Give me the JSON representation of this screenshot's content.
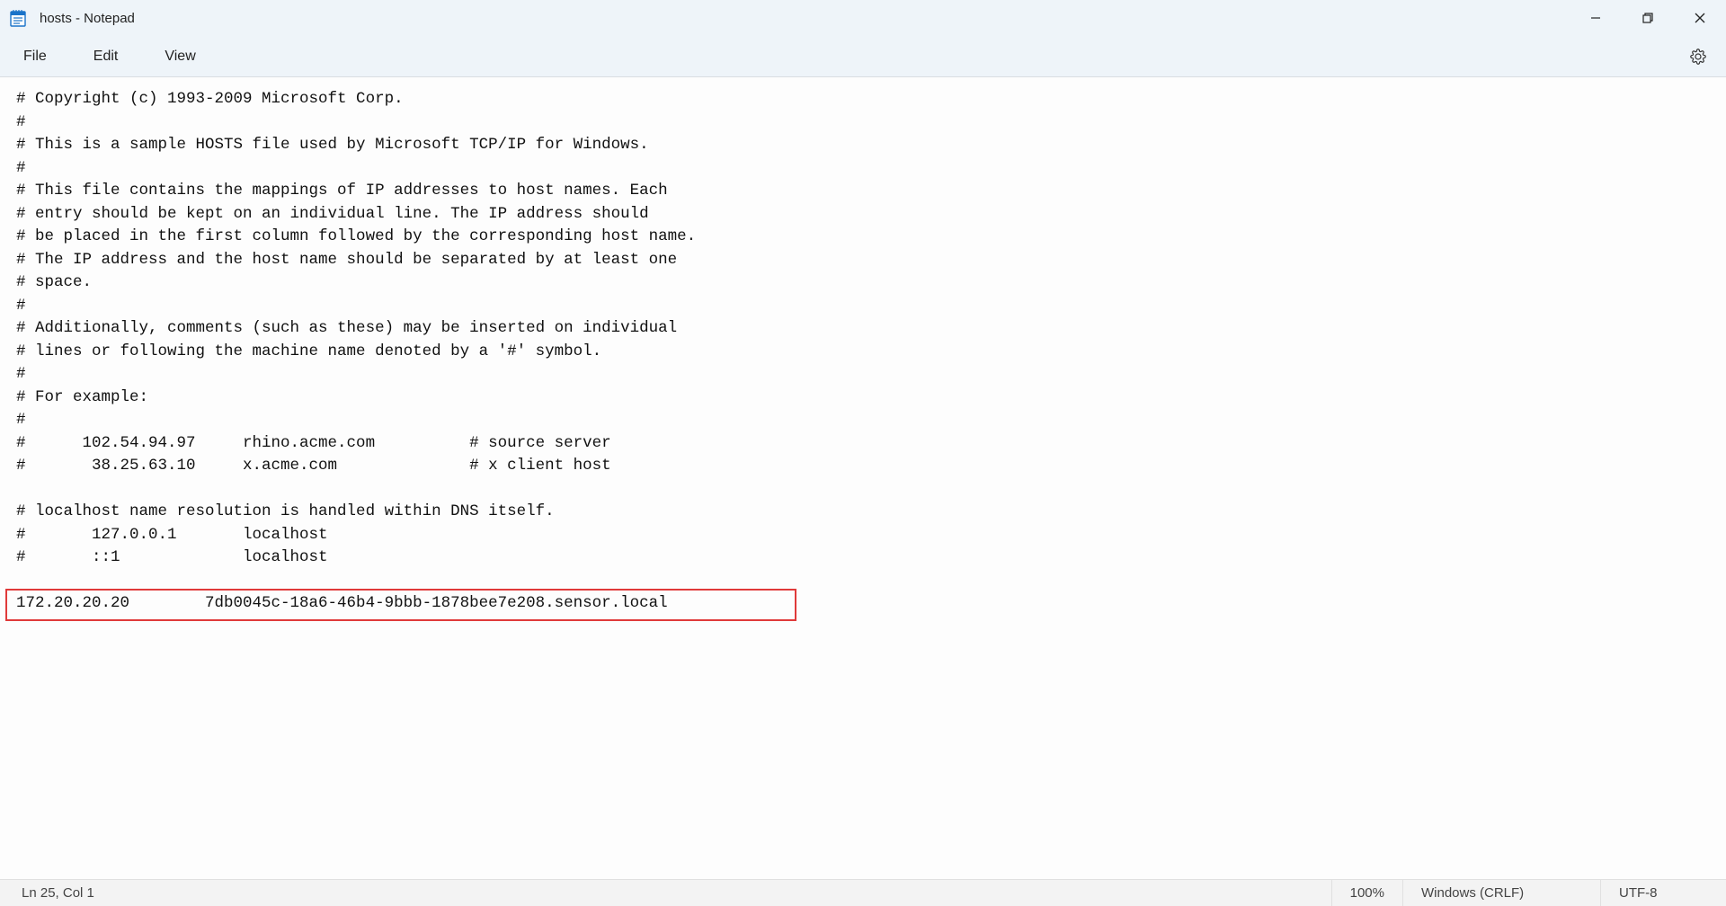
{
  "window": {
    "title": "hosts - Notepad"
  },
  "menu": {
    "file": "File",
    "edit": "Edit",
    "view": "View"
  },
  "content": {
    "lines": [
      "# Copyright (c) 1993-2009 Microsoft Corp.",
      "#",
      "# This is a sample HOSTS file used by Microsoft TCP/IP for Windows.",
      "#",
      "# This file contains the mappings of IP addresses to host names. Each",
      "# entry should be kept on an individual line. The IP address should",
      "# be placed in the first column followed by the corresponding host name.",
      "# The IP address and the host name should be separated by at least one",
      "# space.",
      "#",
      "# Additionally, comments (such as these) may be inserted on individual",
      "# lines or following the machine name denoted by a '#' symbol.",
      "#",
      "# For example:",
      "#",
      "#      102.54.94.97     rhino.acme.com          # source server",
      "#       38.25.63.10     x.acme.com              # x client host",
      "",
      "# localhost name resolution is handled within DNS itself.",
      "#\t127.0.0.1       localhost",
      "#\t::1             localhost",
      "",
      "172.20.20.20        7db0045c-18a6-46b4-9bbb-1878bee7e208.sensor.local"
    ]
  },
  "status": {
    "position": "Ln 25, Col 1",
    "zoom": "100%",
    "line_ending": "Windows (CRLF)",
    "encoding": "UTF-8"
  }
}
